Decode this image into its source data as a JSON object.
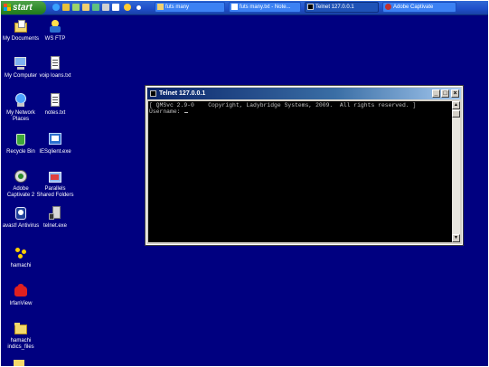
{
  "taskbar": {
    "start_label": "start",
    "quick_launch": [
      "ie-icon",
      "outlook-icon",
      "media-icon",
      "folder-icon",
      "network-icon",
      "settings-icon",
      "calendar-icon",
      "gear-icon"
    ],
    "tasks": [
      {
        "label": "futs many",
        "icon": "folder-icon",
        "active": false
      },
      {
        "label": "futs many.txt - Note...",
        "icon": "notepad-icon",
        "active": false
      },
      {
        "label": "Telnet 127.0.0.1",
        "icon": "console-icon",
        "active": true
      },
      {
        "label": "Adobe Captivate",
        "icon": "captivate-icon",
        "active": false
      }
    ]
  },
  "desktop": {
    "icons": [
      {
        "label": "My Documents",
        "icon": "my-documents-icon"
      },
      {
        "label": "WS FTP",
        "icon": "ws-ftp-icon"
      },
      {
        "label": "My Computer",
        "icon": "my-computer-icon"
      },
      {
        "label": "voip loans.txt",
        "icon": "text-file-icon"
      },
      {
        "label": "My Network Places",
        "icon": "network-places-icon"
      },
      {
        "label": "notes.txt",
        "icon": "text-file-icon"
      },
      {
        "label": "Recycle Bin",
        "icon": "recycle-bin-icon"
      },
      {
        "label": "IESqlient.exe",
        "icon": "exe-icon"
      },
      {
        "label": "Adobe Captivate 2",
        "icon": "captivate-icon"
      },
      {
        "label": "Parallels Shared Folders",
        "icon": "shared-folders-icon"
      },
      {
        "label": "avast! Antivirus",
        "icon": "antivirus-icon"
      },
      {
        "label": "telnet.exe",
        "icon": "telnet-exe-icon"
      },
      {
        "label": "hamachi",
        "icon": "hamachi-icon"
      },
      {
        "label": "IrfanView",
        "icon": "irfanview-icon"
      },
      {
        "label": "hamachi indics_files",
        "icon": "folder-icon"
      }
    ]
  },
  "telnet_window": {
    "title": "Telnet 127.0.0.1",
    "buttons": {
      "minimize": "_",
      "maximize": "□",
      "close": "×"
    },
    "console_lines": [
      "[ QMSvc 2.9-0    Copyright, Ladybridge Systems, 2009.  All rights reserved. ]",
      "Username: "
    ]
  },
  "colors": {
    "desktop": "#000080",
    "taskbar": "#245edb",
    "start_button": "#3a9a34",
    "title_bar": "#0a246a",
    "console_bg": "#000000",
    "console_text": "#c0c0c0"
  }
}
